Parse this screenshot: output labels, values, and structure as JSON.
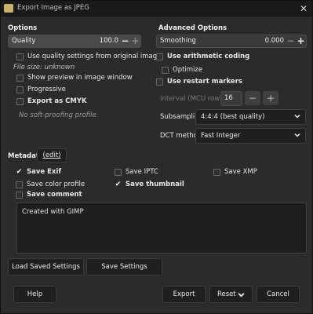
{
  "window": {
    "title": "Export Image as JPEG",
    "close_glyph": "✕"
  },
  "options": {
    "header": "Options",
    "quality": {
      "label": "Quality",
      "value": "100.0"
    },
    "use_quality_from_original": "Use quality settings from original image",
    "file_size": "File size: unknown",
    "show_preview": "Show preview in image window",
    "progressive": "Progressive",
    "export_cmyk": "Export as CMYK",
    "no_softproof": "No soft-proofing profile"
  },
  "advanced": {
    "header": "Advanced Options",
    "smoothing": {
      "label": "Smoothing",
      "value": "0.000"
    },
    "use_arithmetic": "Use arithmetic coding",
    "optimize": "Optimize",
    "use_restart": "Use restart markers",
    "interval_label": "Interval (MCU rows):",
    "interval_value": "16",
    "subsampling_label": "Subsampling",
    "subsampling_value": "4:4:4 (best quality)",
    "dct_label": "DCT method",
    "dct_value": "Fast Integer"
  },
  "metadata": {
    "header": "Metadata",
    "edit_label": "(edit)",
    "save_exif": "Save Exif",
    "save_iptc": "Save IPTC",
    "save_xmp": "Save XMP",
    "save_color_profile": "Save color profile",
    "save_thumbnail": "Save thumbnail",
    "save_comment": "Save comment",
    "comment_text": "Created with GIMP"
  },
  "buttons": {
    "load_saved": "Load Saved Settings",
    "save_settings": "Save Settings",
    "help": "Help",
    "export": "Export",
    "reset": "Reset",
    "cancel": "Cancel"
  },
  "glyphs": {
    "minus": "−",
    "plus": "+",
    "check": "✔"
  }
}
